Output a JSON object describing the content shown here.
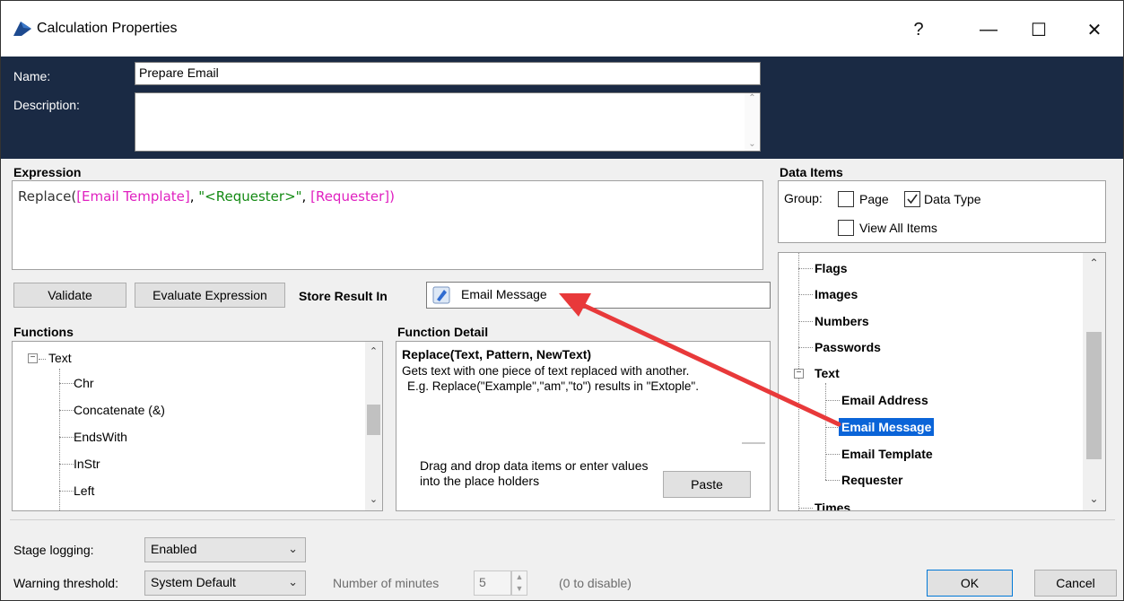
{
  "window": {
    "title": "Calculation Properties",
    "help": "?",
    "minimize": "—",
    "maximize": "☐",
    "close": "✕"
  },
  "header": {
    "name_label": "Name:",
    "name_value": "Prepare Email",
    "description_label": "Description:",
    "description_value": ""
  },
  "expression": {
    "label": "Expression",
    "func": "Replace(",
    "arg1": "[Email Template]",
    "sep1": ", ",
    "arg2": "\"<Requester>\"",
    "sep2": ", ",
    "arg3": "[Requester]",
    "close": ")"
  },
  "toolbar": {
    "validate": "Validate",
    "evaluate": "Evaluate Expression",
    "store_label": "Store Result In",
    "store_value": "Email Message"
  },
  "functions": {
    "label": "Functions",
    "group": "Text",
    "items": [
      "Chr",
      "Concatenate (&)",
      "EndsWith",
      "InStr",
      "Left"
    ]
  },
  "function_detail": {
    "label": "Function Detail",
    "signature": "Replace(Text, Pattern, NewText)",
    "desc": "Gets text with one piece of text replaced with another.",
    "example": "E.g. Replace(\"Example\",\"am\",\"to\") results in \"Extople\".",
    "hint": "Drag and drop data items or enter values into the place holders",
    "paste": "Paste"
  },
  "data_items": {
    "label": "Data Items",
    "group_label": "Group:",
    "page": "Page",
    "page_checked": false,
    "data_type": "Data Type",
    "data_type_checked": true,
    "view_all": "View All Items",
    "view_all_checked": false,
    "tree": {
      "flags": "Flags",
      "images": "Images",
      "numbers": "Numbers",
      "passwords": "Passwords",
      "text": "Text",
      "text_children": [
        "Email Address",
        "Email Message",
        "Email Template",
        "Requester"
      ],
      "times": "Times"
    },
    "selected": "Email Message"
  },
  "footer": {
    "stage_logging_label": "Stage logging:",
    "stage_logging_value": "Enabled",
    "warning_label": "Warning threshold:",
    "warning_value": "System Default",
    "minutes_label": "Number of minutes",
    "minutes_value": "5",
    "minutes_hint": "(0 to disable)",
    "ok": "OK",
    "cancel": "Cancel"
  },
  "colors": {
    "header_bg": "#1a2a44",
    "field_color": "#e020c0",
    "string_color": "#138a13",
    "selection": "#0a64d8",
    "arrow": "#e8393a"
  }
}
